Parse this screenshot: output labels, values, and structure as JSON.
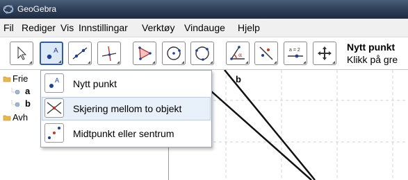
{
  "window": {
    "title": "GeoGebra"
  },
  "menu": [
    "Fil",
    "Rediger",
    "Vis",
    "Innstillingar",
    "Verktøy",
    "Vindauge",
    "Hjelp"
  ],
  "toolbar": {
    "tools": [
      {
        "name": "move-tool",
        "icon": "arrow-cursor-icon"
      },
      {
        "name": "new-point-tool",
        "icon": "point-icon",
        "active": true
      },
      {
        "name": "line-tool",
        "icon": "line-through-two-points-icon"
      },
      {
        "name": "perpendicular-line-tool",
        "icon": "perpendicular-line-icon"
      },
      {
        "name": "polygon-tool",
        "icon": "polygon-icon"
      },
      {
        "name": "circle-tool",
        "icon": "circle-center-point-icon"
      },
      {
        "name": "circle-three-points-tool",
        "icon": "circle-three-points-icon"
      },
      {
        "name": "angle-tool",
        "icon": "angle-icon"
      },
      {
        "name": "reflect-tool",
        "icon": "reflect-icon"
      },
      {
        "name": "slider-tool",
        "icon": "slider-icon",
        "label": "a = 2"
      },
      {
        "name": "move-view-tool",
        "icon": "move-graphics-view-icon"
      }
    ],
    "help_title": "Nytt punkt",
    "help_text": "Klikk på gre"
  },
  "algebra": {
    "free_label": "Frie",
    "free_items": [
      "a",
      "b"
    ],
    "dependent_label": "Avh"
  },
  "graphics": {
    "line_label": "b"
  },
  "dropdown": {
    "items": [
      {
        "label": "Nytt punkt",
        "icon": "new-point-icon"
      },
      {
        "label": "Skjering mellom to objekt",
        "icon": "intersect-two-objects-icon"
      },
      {
        "label": "Midtpunkt eller sentrum",
        "icon": "midpoint-icon"
      }
    ]
  },
  "colors": {
    "point": "#1c3f9e",
    "accent": "#c0392b",
    "titlebar": "#2f4058"
  }
}
